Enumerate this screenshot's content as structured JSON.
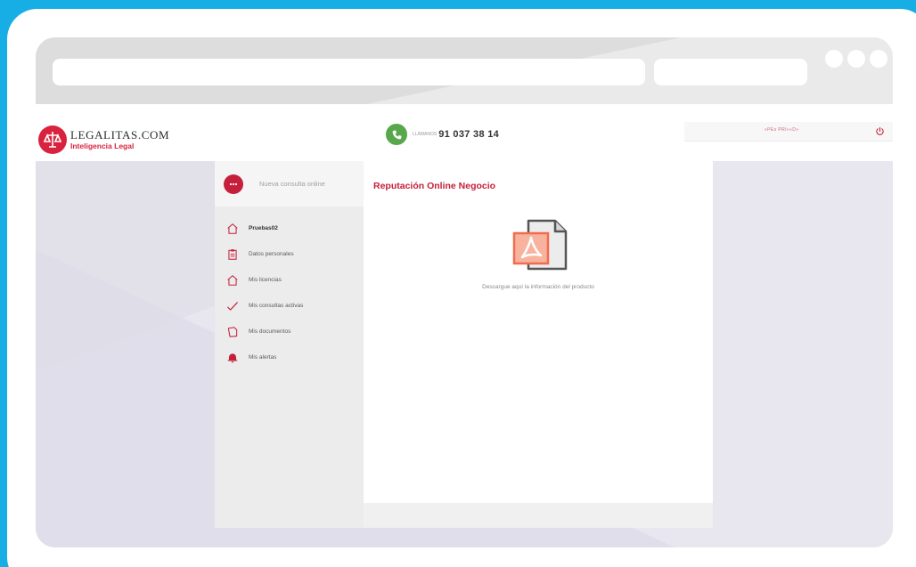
{
  "header": {
    "brand_name": "LEGALITAS.COM",
    "brand_tagline": "Inteligencia Legal",
    "phone_label": "LLÁMANOS",
    "phone_number": "91 037 38 14",
    "user_name": "«PEs PRI»«D»"
  },
  "sidebar": {
    "new_consult_label": "Nueva consulta online",
    "items": [
      {
        "label": "Pruebas02",
        "icon": "home-icon",
        "active": true
      },
      {
        "label": "Datos personales",
        "icon": "clipboard-icon",
        "active": false
      },
      {
        "label": "Mis licencias",
        "icon": "home-outline-icon",
        "active": false
      },
      {
        "label": "Mis consultas activas",
        "icon": "pencil-check-icon",
        "active": false
      },
      {
        "label": "Mis documentos",
        "icon": "document-icon",
        "active": false
      },
      {
        "label": "Mis alertas",
        "icon": "bell-icon",
        "active": false
      }
    ]
  },
  "main": {
    "title": "Reputación Online Negocio",
    "download_label": "Descargue aquí la información del producto"
  },
  "colors": {
    "background": "#16aee4",
    "accent": "#c5203b",
    "phone_green": "#57a84b",
    "pdf_orange": "#f26b4f"
  }
}
